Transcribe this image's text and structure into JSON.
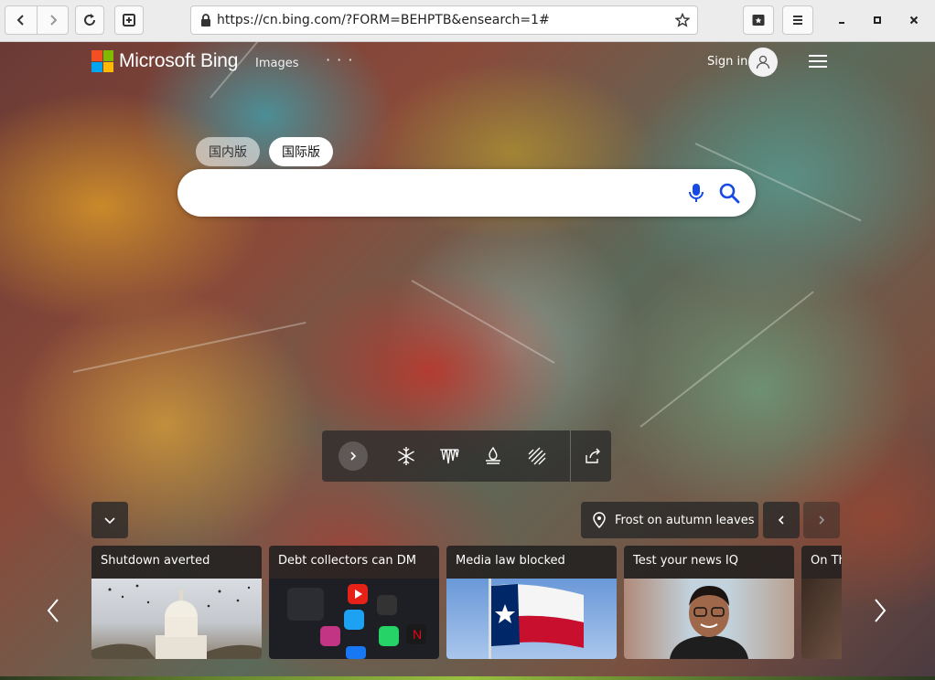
{
  "browser": {
    "url": "https://cn.bing.com/?FORM=BEHPTB&ensearch=1#",
    "icons": {
      "back": "chevron-left-icon",
      "forward": "chevron-right-icon",
      "reload": "reload-icon",
      "new_tab": "new-tab-icon",
      "lock": "lock-icon",
      "bookmark": "star-icon",
      "tab_overview": "tab-overview-icon",
      "menu": "menu-icon",
      "minimize": "minimize-icon",
      "maximize": "maximize-icon",
      "close": "close-icon"
    }
  },
  "bing": {
    "brand": "Microsoft Bing",
    "nav_images": "Images",
    "nav_more": "· · ·",
    "sign_in": "Sign in",
    "region_tabs": [
      "国内版",
      "国际版"
    ],
    "search_placeholder": "",
    "colors": {
      "logo": [
        "#f25022",
        "#7fba00",
        "#00a4ef",
        "#ffb900"
      ],
      "search_icon": "#174ae4"
    },
    "toolbar_icons": [
      "next-image-icon",
      "snowflake-icon",
      "icicles-icon",
      "campfire-icon",
      "frost-icon",
      "share-icon"
    ],
    "caption": "Frost on autumn leaves",
    "cards": [
      {
        "title": "Shutdown averted"
      },
      {
        "title": "Debt collectors can DM"
      },
      {
        "title": "Media law blocked"
      },
      {
        "title": "Test your news IQ"
      },
      {
        "title": "On Th"
      }
    ]
  }
}
